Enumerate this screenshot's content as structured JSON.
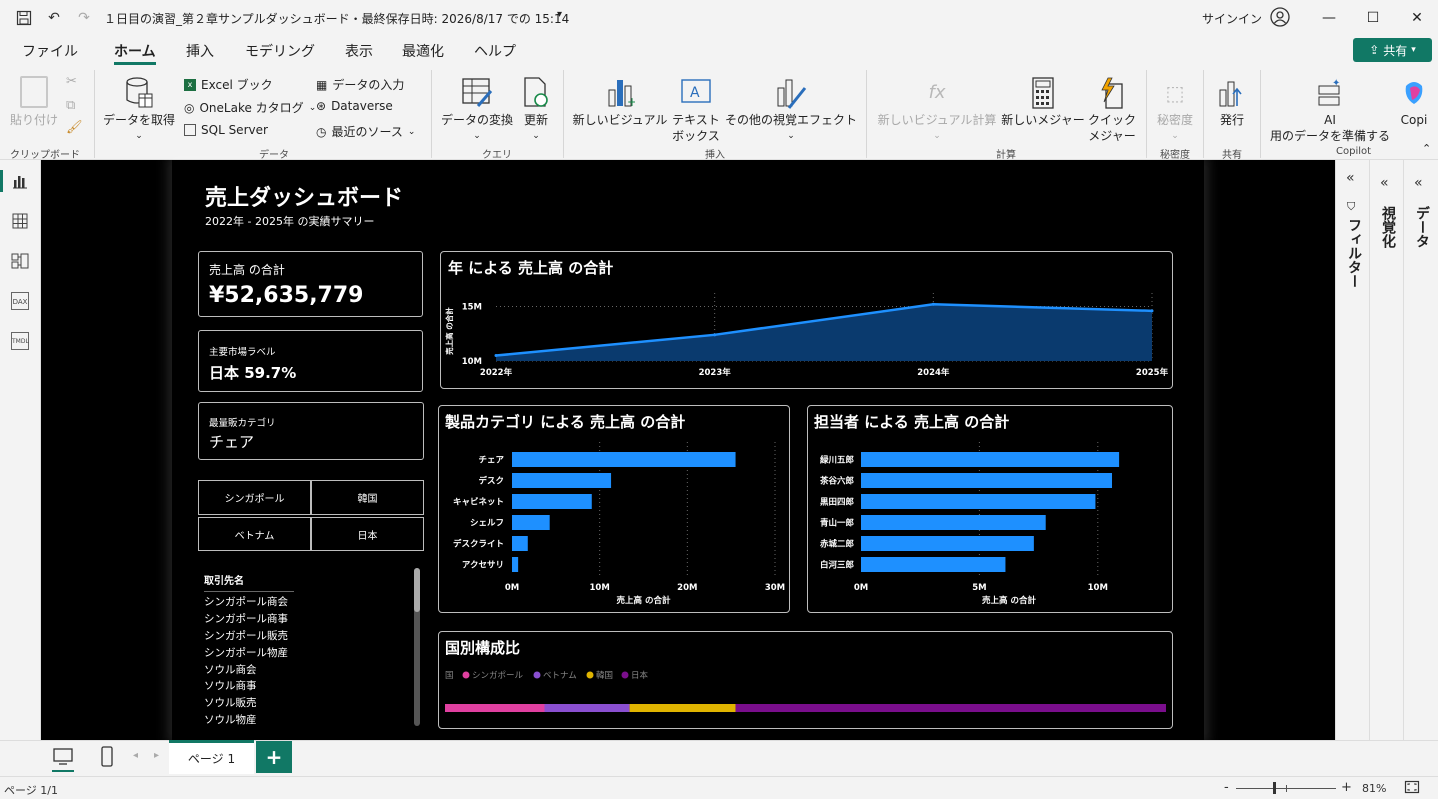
{
  "window": {
    "title": "１日目の演習_第２章サンプルダッシュボード・最終保存日時: 2026/8/17 での 15:14",
    "sign_in": "サインイン"
  },
  "menu": {
    "items": [
      "ファイル",
      "ホーム",
      "挿入",
      "モデリング",
      "表示",
      "最適化",
      "ヘルプ"
    ],
    "active": "ホーム",
    "share": "共有"
  },
  "ribbon": {
    "clipboard": {
      "paste": "貼り付け",
      "group": "クリップボード"
    },
    "data": {
      "get_data": "データを取得",
      "excel": "Excel ブック",
      "onelake": "OneLake カタログ",
      "sql": "SQL Server",
      "enter_data": "データの入力",
      "dataverse": "Dataverse",
      "recent": "最近のソース",
      "group": "データ"
    },
    "query": {
      "transform": "データの変換",
      "refresh": "更新",
      "group": "クエリ"
    },
    "insert": {
      "new_visual": "新しいビジュアル",
      "textbox_1": "テキスト",
      "textbox_2": "ボックス",
      "more_visuals": "その他の視覚エフェクト",
      "group": "挿入"
    },
    "calc": {
      "new_visual_calc": "新しいビジュアル計算",
      "new_measure": "新しいメジャー",
      "quick_1": "クイック",
      "quick_2": "メジャー",
      "group": "計算"
    },
    "sensitivity": {
      "label": "秘密度",
      "group": "秘密度"
    },
    "share": {
      "publish": "発行",
      "group": "共有"
    },
    "copilot": {
      "ai_1": "AI",
      "ai_2": "用のデータを準備する",
      "copilot": "Copi",
      "group": "Copilot"
    }
  },
  "report": {
    "title": "売上ダッシュボード",
    "subtitle": "2022年 - 2025年 の実績サマリー",
    "kpi_total": {
      "label": "売上高 の合計",
      "value": "¥52,635,779"
    },
    "kpi_market": {
      "label": "主要市場ラベル",
      "value": "日本 59.7%"
    },
    "kpi_category": {
      "label": "最量販カテゴリ",
      "value": "チェア"
    },
    "country_buttons": [
      "シンガポール",
      "韓国",
      "ベトナム",
      "日本"
    ],
    "customer_list": {
      "header": "取引先名",
      "items": [
        "シンガポール商会",
        "シンガポール商事",
        "シンガポール販売",
        "シンガポール物産",
        "ソウル商会",
        "ソウル商事",
        "ソウル販売",
        "ソウル物産"
      ]
    },
    "line_chart_title": "年 による 売上高 の合計",
    "bar_category_title": "製品カテゴリ による 売上高 の合計",
    "bar_person_title": "担当者 による 売上高 の合計",
    "composition_title": "国別構成比"
  },
  "chart_data": [
    {
      "type": "area",
      "title": "年 による 売上高 の合計",
      "x": [
        "2022年",
        "2023年",
        "2024年",
        "2025年"
      ],
      "values": [
        10.5,
        12.4,
        15.2,
        14.6
      ],
      "ylabel": "売上高 の合計",
      "yticks": [
        "10M",
        "15M"
      ],
      "ylim": [
        10,
        15.5
      ],
      "color": "#1e90ff"
    },
    {
      "type": "bar",
      "title": "製品カテゴリ による 売上高 の合計",
      "categories": [
        "チェア",
        "デスク",
        "キャビネット",
        "シェルフ",
        "デスクライト",
        "アクセサリ"
      ],
      "values": [
        25.5,
        11.3,
        9.1,
        4.3,
        1.8,
        0.7
      ],
      "xlabel": "売上高 の合計",
      "xticks": [
        "0M",
        "10M",
        "20M",
        "30M"
      ],
      "xlim": [
        0,
        30
      ],
      "color": "#1e90ff"
    },
    {
      "type": "bar",
      "title": "担当者 による 売上高 の合計",
      "categories": [
        "緑川五郎",
        "茶谷六郎",
        "黒田四郎",
        "青山一郎",
        "赤城二郎",
        "白河三郎"
      ],
      "values": [
        10.9,
        10.6,
        9.9,
        7.8,
        7.3,
        6.1
      ],
      "xlabel": "売上高 の合計",
      "xticks": [
        "0M",
        "5M",
        "10M"
      ],
      "xlim": [
        0,
        12.5
      ],
      "color": "#1e90ff"
    },
    {
      "type": "bar",
      "title": "国別構成比",
      "legend_title": "国",
      "series": [
        {
          "name": "シンガポール",
          "value": 13.8,
          "color": "#e040a0"
        },
        {
          "name": "ベトナム",
          "value": 11.8,
          "color": "#8a4fd0"
        },
        {
          "name": "韓国",
          "value": 14.7,
          "color": "#e0b400"
        },
        {
          "name": "日本",
          "value": 59.7,
          "color": "#7a0e8c"
        }
      ]
    }
  ],
  "right_panes": {
    "filter": "フィルター",
    "visual": "視覚化",
    "data": "データ"
  },
  "pages": {
    "tab": "ページ 1",
    "add": "+"
  },
  "status": {
    "page": "ページ 1/1",
    "zoom": "81%",
    "minus": "-",
    "plus": "+"
  }
}
